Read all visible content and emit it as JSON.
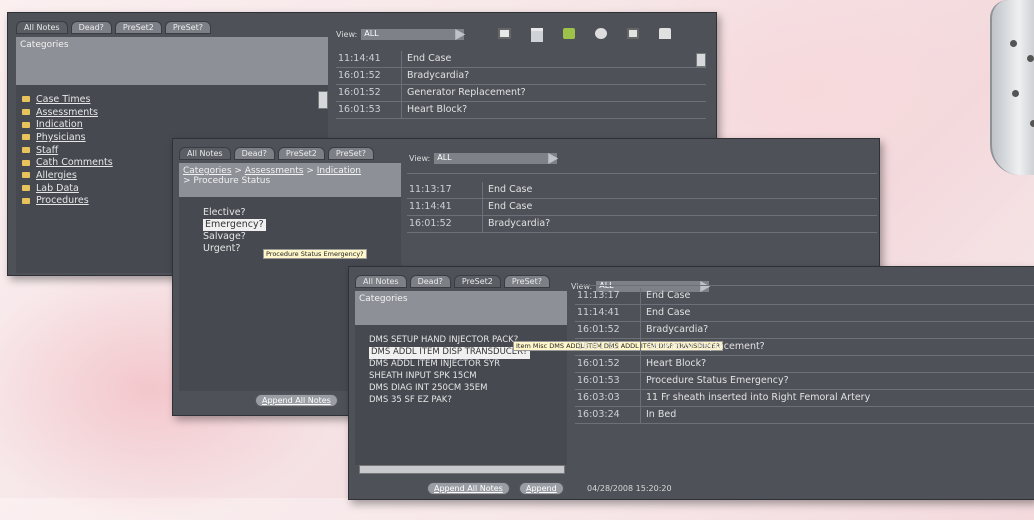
{
  "view_label": "View:",
  "view_value": "ALL",
  "tabs": [
    "All Notes",
    "Dead?",
    "PreSet2",
    "PreSet?"
  ],
  "w1": {
    "cat_header": "Categories",
    "categories": [
      "Case Times",
      "Assessments",
      "Indication",
      "Physicians",
      "Staff",
      "Cath Comments",
      "Allergies",
      "Lab Data",
      "Procedures"
    ],
    "notes": [
      {
        "time": "11:14:41",
        "note": "End Case"
      },
      {
        "time": "16:01:52",
        "note": "Bradycardia?"
      },
      {
        "time": "16:01:52",
        "note": "Generator Replacement?"
      },
      {
        "time": "16:01:53",
        "note": "Heart Block?"
      }
    ]
  },
  "w2": {
    "crumb1": "Categories",
    "crumb2": "Assessments",
    "crumb3": "Indication",
    "crumb4": "Procedure Status",
    "options": [
      "Elective?",
      "Emergency?",
      "Salvage?",
      "Urgent?"
    ],
    "tooltip": "Procedure Status Emergency?",
    "notes": [
      {
        "time": "11:13:17",
        "note": "End Case"
      },
      {
        "time": "11:14:41",
        "note": "End Case"
      },
      {
        "time": "16:01:52",
        "note": "Bradycardia?"
      }
    ],
    "append_btn": "Append All Notes"
  },
  "w3": {
    "cat_header": "Categories",
    "items": [
      "DMS SETUP HAND INJECTOR PACK?",
      "DMS ADDL ITEM DISP TRANSDUCER?",
      "DMS ADDL ITEM INJECTOR SYR",
      "SHEATH INPUT SPK 15CM",
      "DMS DIAG INT 250CM 35EM",
      "DMS 35 SF EZ PAK?"
    ],
    "tooltip": "Item Misc DMS ADDL ITEM DMS ADDL ITEM DISP TRANSDUCER",
    "notes": [
      {
        "time": "11:13:17",
        "note": "End Case"
      },
      {
        "time": "11:14:41",
        "note": "End Case"
      },
      {
        "time": "16:01:52",
        "note": "Bradycardia?"
      },
      {
        "time": "16:01:52",
        "note": "Generator Replacement?"
      },
      {
        "time": "16:01:52",
        "note": "Heart Block?"
      },
      {
        "time": "16:01:53",
        "note": "Procedure Status Emergency?"
      },
      {
        "time": "16:03:03",
        "note": "11 Fr sheath inserted into Right Femoral Artery"
      },
      {
        "time": "16:03:24",
        "note": "In Bed"
      }
    ],
    "append_btn": "Append All Notes",
    "append2": "Append",
    "timestamp": "04/28/2008 15:20:20"
  }
}
